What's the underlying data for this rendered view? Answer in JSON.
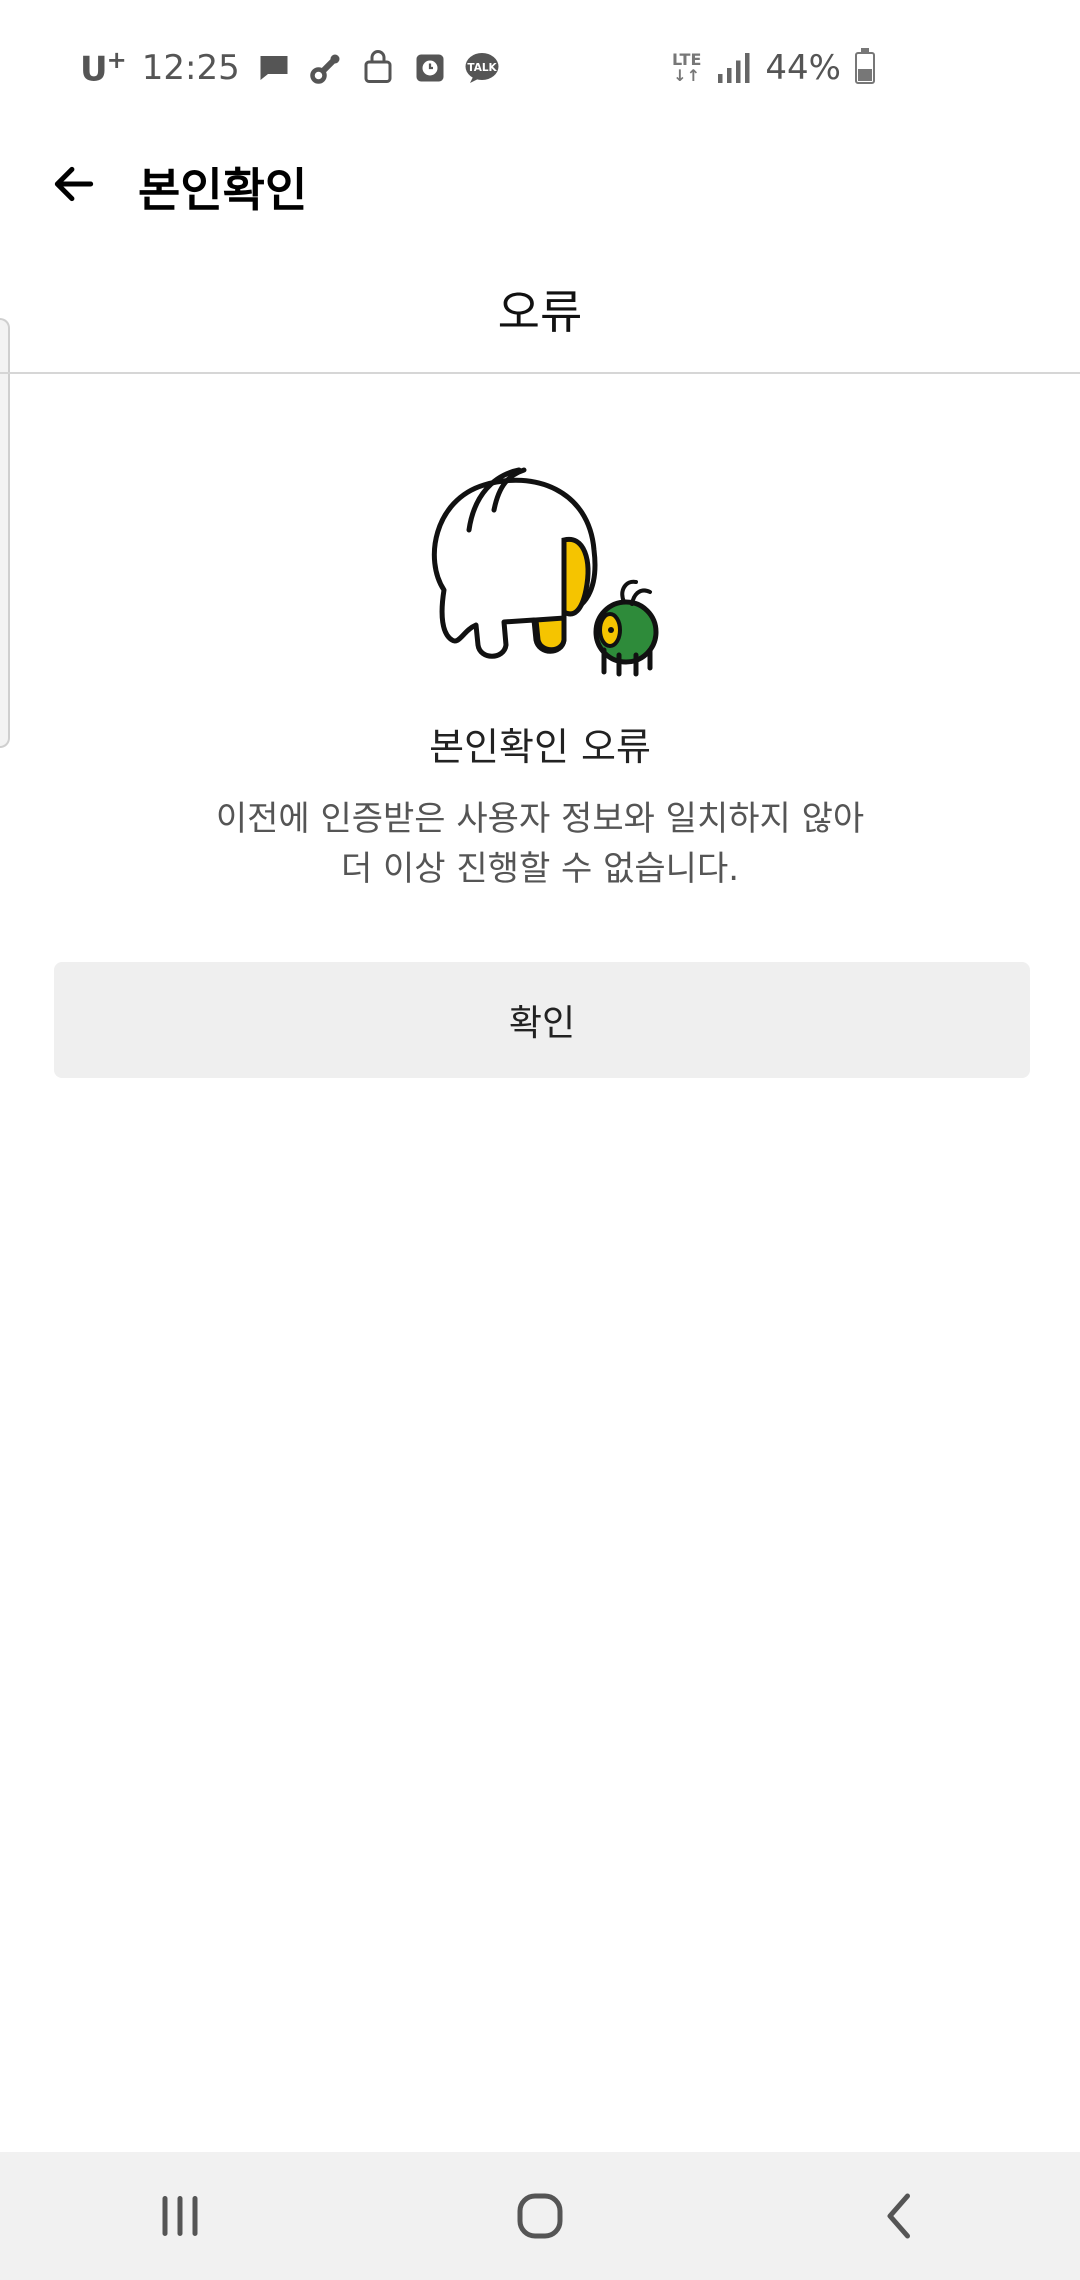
{
  "status_bar": {
    "carrier": "U",
    "carrier_sup": "+",
    "time": "12:25",
    "network": "LTE",
    "battery_percent": "44%",
    "battery_level": 0.44,
    "notification_icons": [
      "message-icon",
      "tool-icon",
      "bag-icon",
      "clock-app-icon",
      "kakaotalk-icon"
    ]
  },
  "header": {
    "title": "본인확인"
  },
  "dialog": {
    "title": "오류",
    "heading": "본인확인 오류",
    "message_line1": "이전에 인증받은 사용자 정보와 일치하지 않아",
    "message_line2": "더 이상 진행할 수 없습니다.",
    "confirm_label": "확인"
  },
  "nav_bar": {
    "icons": [
      "recent-apps-icon",
      "home-icon",
      "back-icon"
    ]
  },
  "colors": {
    "background": "#ffffff",
    "button_bg": "#efefef",
    "nav_bg": "#f1f1f1",
    "character_yellow": "#f5c400",
    "character_green": "#2e8b3a"
  }
}
